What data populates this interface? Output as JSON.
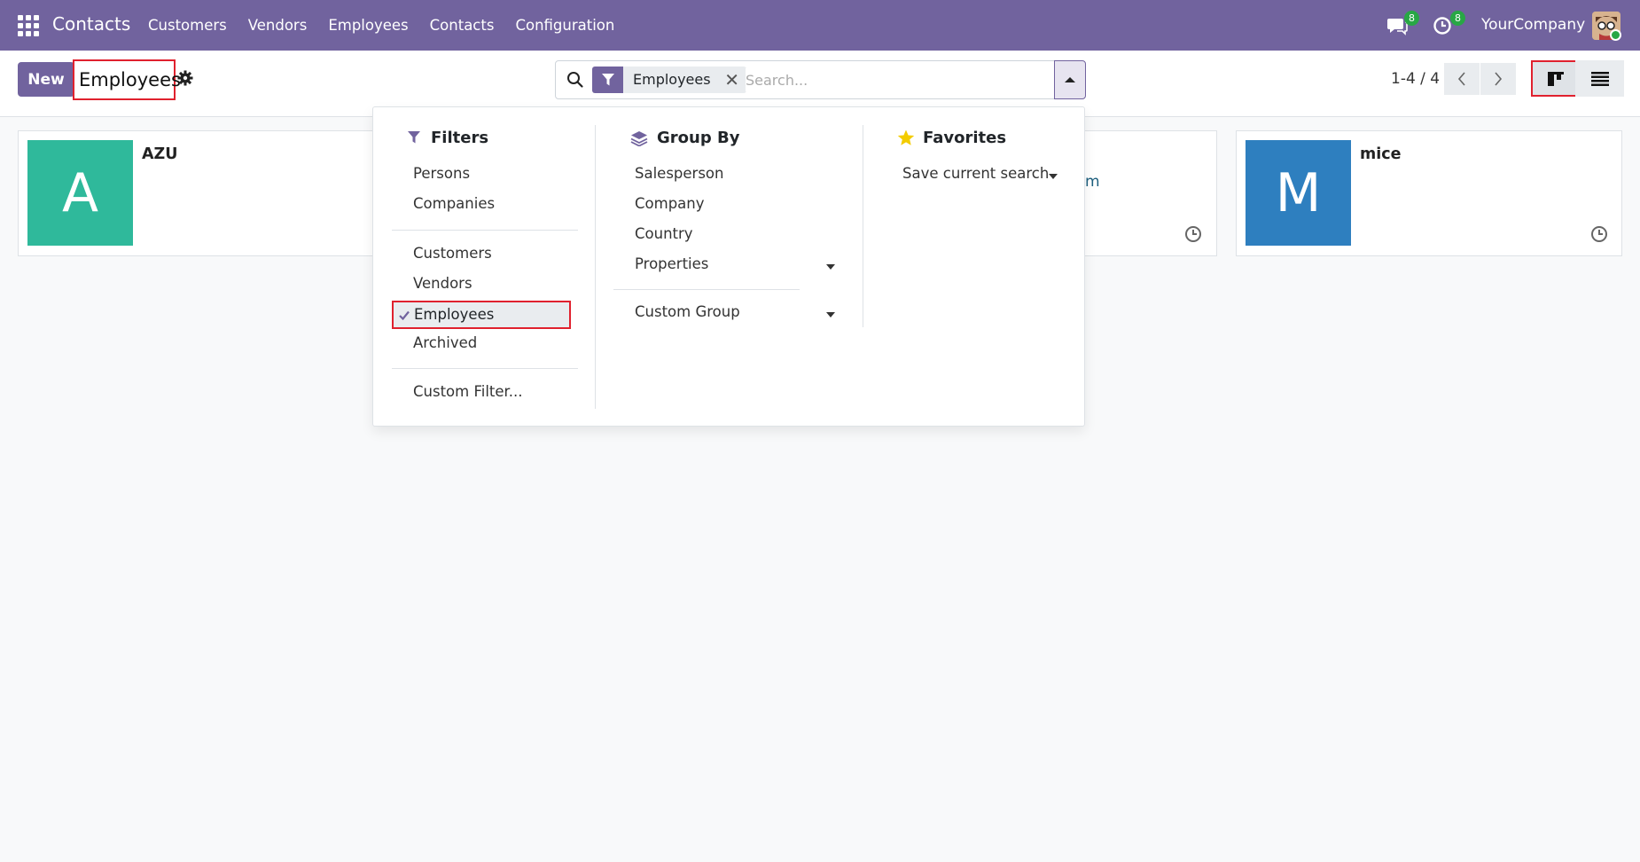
{
  "navbar": {
    "brand": "Contacts",
    "menu": [
      "Customers",
      "Vendors",
      "Employees",
      "Contacts",
      "Configuration"
    ],
    "messages_badge": "8",
    "activities_badge": "8",
    "company": "YourCompany"
  },
  "control_panel": {
    "new_label": "New",
    "breadcrumb": "Employees",
    "search": {
      "facet_label": "Employees",
      "facet_remove": "✕",
      "placeholder": "Search..."
    },
    "pager": "1-4 / 4"
  },
  "cards": [
    {
      "initial": "A",
      "name": "AZU",
      "color": "#2fb99b"
    },
    {
      "initial": "M",
      "name": "mice",
      "color": "#2e7fbf"
    }
  ],
  "partial_card_text": "m",
  "dropdown": {
    "filters": {
      "title": "Filters",
      "group1": [
        "Persons",
        "Companies"
      ],
      "group2": [
        "Customers",
        "Vendors"
      ],
      "selected": "Employees",
      "archived": "Archived",
      "custom": "Custom Filter..."
    },
    "group_by": {
      "title": "Group By",
      "items": [
        "Salesperson",
        "Company",
        "Country",
        "Properties"
      ],
      "custom": "Custom Group"
    },
    "favorites": {
      "title": "Favorites",
      "save": "Save current search"
    }
  },
  "colors": {
    "brand": "#71639e",
    "highlight": "#e0212e",
    "badge": "#28a745",
    "favorite_star": "#f3cc00"
  }
}
